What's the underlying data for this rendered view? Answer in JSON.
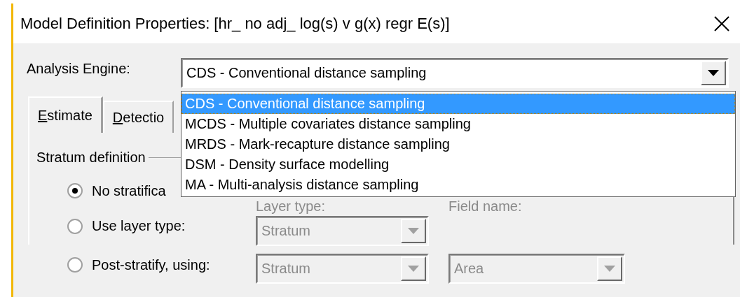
{
  "window": {
    "title": "Model Definition Properties: [hr_ no adj_ log(s) v g(x) regr E(s)]"
  },
  "analysis_engine": {
    "label": "Analysis Engine:",
    "value": "CDS - Conventional distance sampling",
    "expanded": true,
    "options": [
      {
        "label": "CDS - Conventional distance sampling",
        "selected": true
      },
      {
        "label": "MCDS - Multiple covariates distance sampling",
        "selected": false
      },
      {
        "label": "MRDS - Mark-recapture distance sampling",
        "selected": false
      },
      {
        "label": "DSM - Density surface modelling",
        "selected": false
      },
      {
        "label": "MA - Multi-analysis distance sampling",
        "selected": false
      }
    ]
  },
  "tabs": [
    {
      "label": "Estimate",
      "selected": true
    },
    {
      "label": "Detectio",
      "selected": false
    }
  ],
  "stratum_definition": {
    "title": "Stratum definition",
    "options": [
      {
        "label": "No stratifica",
        "selected": true
      },
      {
        "label": "Use layer type:",
        "selected": false
      },
      {
        "label": "Post-stratify, using:",
        "selected": false
      }
    ],
    "layer_type_label": "Layer type:",
    "field_name_label": "Field name:",
    "layer_type_fields": [
      {
        "value": "Stratum",
        "disabled": true
      },
      {
        "value": "Stratum",
        "disabled": true
      }
    ],
    "field_name_field": {
      "value": "Area",
      "disabled": true
    }
  }
}
